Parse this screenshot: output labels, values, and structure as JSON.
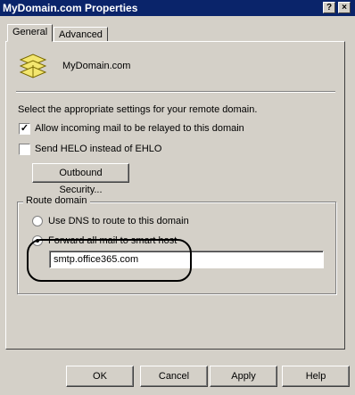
{
  "window": {
    "title": "MyDomain.com Properties",
    "help_glyph": "?",
    "close_glyph": "×"
  },
  "tabs": [
    {
      "label": "General"
    },
    {
      "label": "Advanced"
    }
  ],
  "general": {
    "domain_name": "MyDomain.com",
    "instructions": "Select the appropriate settings for your remote domain.",
    "allow_relay": {
      "label": "Allow incoming mail to be relayed to this domain",
      "checked": true
    },
    "send_helo": {
      "label": "Send HELO instead of EHLO",
      "checked": false
    },
    "outbound_button": "Outbound Security...",
    "route": {
      "group_label": "Route domain",
      "use_dns": {
        "label": "Use DNS to route to this domain",
        "selected": false
      },
      "forward": {
        "label": "Forward all mail to smart host",
        "selected": true
      },
      "smart_host_value": "smtp.office365.com"
    }
  },
  "footer": {
    "ok": "OK",
    "cancel": "Cancel",
    "apply": "Apply",
    "help": "Help"
  },
  "colors": {
    "titlebar": "#0a246a",
    "face": "#d4d0c8",
    "icon_yellow": "#f3e66f"
  }
}
